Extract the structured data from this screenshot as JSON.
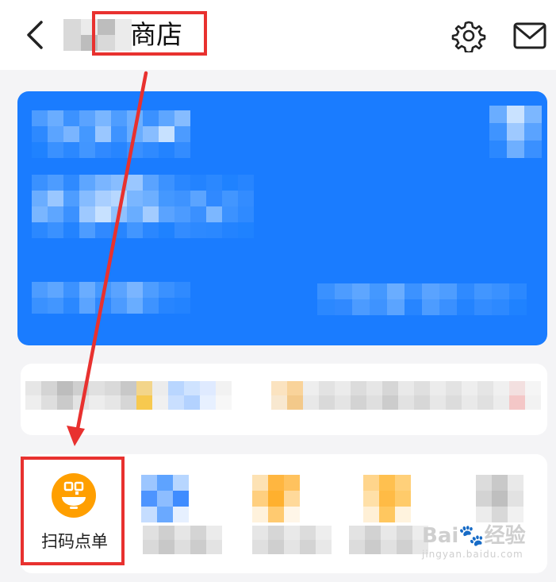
{
  "header": {
    "title": "商店",
    "back_icon": "chevron-left-icon",
    "settings_icon": "gear-icon",
    "mail_icon": "mail-icon"
  },
  "tools": {
    "items": [
      {
        "label": "扫码点单",
        "icon": "qr-bowl-icon"
      }
    ]
  },
  "colors": {
    "accent": "#1a7cff",
    "annotation": "#e8312f",
    "scan_icon": "#ff9f00"
  },
  "watermark": {
    "brand": "Bai",
    "brand_suffix": "经验",
    "url": "jingyan.baidu.com"
  }
}
